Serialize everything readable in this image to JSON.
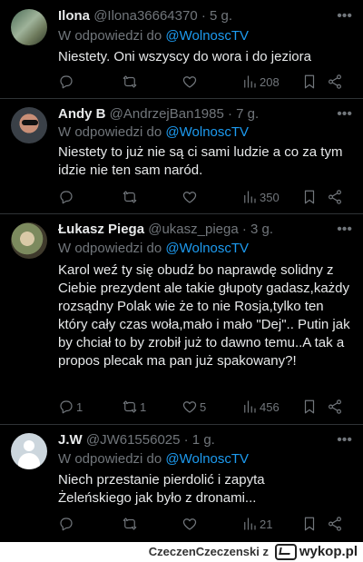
{
  "tweets": [
    {
      "name": "Ilona",
      "handle": "@Ilona36664370",
      "time": "· 5 g.",
      "reply_prefix": "W odpowiedzi do ",
      "reply_mention": "@WolnoscTV",
      "text": "Niestety. Oni wszyscy do wora i do jeziora",
      "replies": "",
      "retweets": "",
      "likes": "",
      "views": "208"
    },
    {
      "name": "Andy B",
      "handle": "@AndrzejBan1985",
      "time": "· 7 g.",
      "reply_prefix": "W odpowiedzi do ",
      "reply_mention": "@WolnoscTV",
      "text": "Niestety to już nie są ci sami ludzie a co za tym idzie nie ten sam naród.",
      "replies": "",
      "retweets": "",
      "likes": "",
      "views": "350"
    },
    {
      "name": "Łukasz Piega",
      "handle": "@ukasz_piega",
      "time": "· 3 g.",
      "reply_prefix": "W odpowiedzi do ",
      "reply_mention": "@WolnoscTV",
      "text": "Karol weź ty się obudź bo naprawdę solidny z Ciebie prezydent ale takie głupoty gadasz,każdy rozsądny Polak wie że to nie Rosja,tylko ten który cały czas woła,mało i mało \"Dej\".. Putin jak by chciał to by zrobił już to dawno temu..A tak a propos plecak ma pan już spakowany?!",
      "replies": "1",
      "retweets": "1",
      "likes": "5",
      "views": "456"
    },
    {
      "name": "J.W",
      "handle": "@JW61556025",
      "time": "· 1 g.",
      "reply_prefix": "W odpowiedzi do ",
      "reply_mention": "@WolnoscTV",
      "text": "Niech przestanie pierdolić i zapyta Żeleńskiego jak było z dronami...",
      "replies": "",
      "retweets": "",
      "likes": "",
      "views": "21"
    }
  ],
  "footer": {
    "username": "CzeczenCzeczenski",
    "suffix": "z",
    "brand": "wykop.pl"
  }
}
